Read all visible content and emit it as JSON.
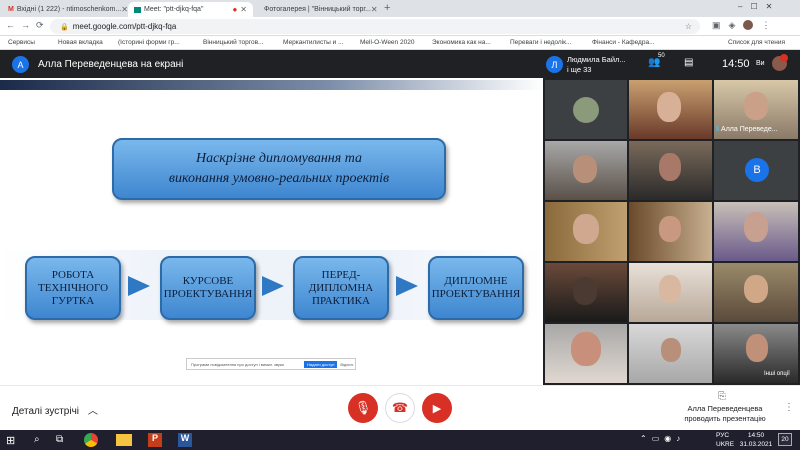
{
  "browser": {
    "tabs": [
      {
        "label": "Вхідні (1 222) - ntimoschenkom...",
        "icon": "gmail-icon"
      },
      {
        "label": "Meet: \"ptt-djkq-fqa\"",
        "icon": "meet-icon"
      },
      {
        "label": "Фотогалерея | \"Вінницький торг...",
        "icon": "site-icon"
      }
    ],
    "url": "meet.google.com/ptt-djkq-fqa",
    "bookmarks": [
      "Сервисы",
      "Новая вкладка",
      "(Історині форми гр...",
      "Вінницький торгов...",
      "Меркантилисты и ...",
      "Mell-O-Ween 2020",
      "Экономика как на...",
      "Переваги і недолік...",
      "Фінанси - Кафедра..."
    ],
    "reading_list": "Список для чтения"
  },
  "meet": {
    "presenter_avatar": "А",
    "presenter_banner": "Алла Переведенцева на екрані",
    "participant_avatar": "Л",
    "participant_name": "Людмила Байл...",
    "participant_more": "і ще 33",
    "people_count": "50",
    "time": "14:50",
    "you_label": "Ви",
    "tile_avatar_v": "В",
    "speaker_label": "Алла Переведе...",
    "more_options": "Інші опції",
    "details_label": "Деталі зустрічі",
    "presenting_name": "Алла Переведенцева",
    "presenting_label": "проводить презентацію",
    "notice_text": "Програми повідомлення про доступ і вимкн. звуки",
    "notice_button": "Надати доступ",
    "notice_skip": "Відхил."
  },
  "slide": {
    "title_line1": "Наскрізне дипломування та",
    "title_line2": "виконання умовно-реальних проектів",
    "steps": [
      {
        "line1": "РОБОТА",
        "line2": "ТЕХНІЧНОГО",
        "line3": "ГУРТКА"
      },
      {
        "line1": "КУРСОВЕ",
        "line2": "ПРОЕКТУВАННЯ",
        "line3": ""
      },
      {
        "line1": "ПЕРЕД-",
        "line2": "ДИПЛОМНА",
        "line3": "ПРАКТИКА"
      },
      {
        "line1": "ДИПЛОМНЕ",
        "line2": "ПРОЕКТУВАННЯ",
        "line3": ""
      }
    ]
  },
  "taskbar": {
    "lang": "РУС",
    "layout": "UKRE",
    "clock": "14:50",
    "date": "31.03.2021",
    "notif": "20"
  }
}
